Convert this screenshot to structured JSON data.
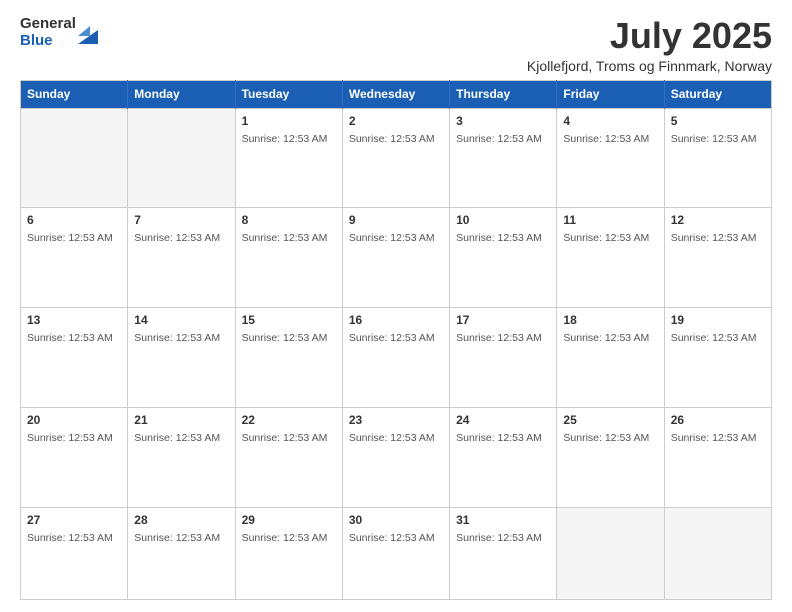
{
  "logo": {
    "general": "General",
    "blue": "Blue"
  },
  "header": {
    "month": "July 2025",
    "location": "Kjollefjord, Troms og Finnmark, Norway"
  },
  "days": [
    "Sunday",
    "Monday",
    "Tuesday",
    "Wednesday",
    "Thursday",
    "Friday",
    "Saturday"
  ],
  "sunrise_label": "Sunrise: 12:53 AM",
  "weeks": [
    [
      {
        "day": "",
        "empty": true
      },
      {
        "day": "",
        "empty": true
      },
      {
        "day": "1",
        "empty": false
      },
      {
        "day": "2",
        "empty": false
      },
      {
        "day": "3",
        "empty": false
      },
      {
        "day": "4",
        "empty": false
      },
      {
        "day": "5",
        "empty": false
      }
    ],
    [
      {
        "day": "6",
        "empty": false
      },
      {
        "day": "7",
        "empty": false
      },
      {
        "day": "8",
        "empty": false
      },
      {
        "day": "9",
        "empty": false
      },
      {
        "day": "10",
        "empty": false
      },
      {
        "day": "11",
        "empty": false
      },
      {
        "day": "12",
        "empty": false
      }
    ],
    [
      {
        "day": "13",
        "empty": false
      },
      {
        "day": "14",
        "empty": false
      },
      {
        "day": "15",
        "empty": false
      },
      {
        "day": "16",
        "empty": false
      },
      {
        "day": "17",
        "empty": false
      },
      {
        "day": "18",
        "empty": false
      },
      {
        "day": "19",
        "empty": false
      }
    ],
    [
      {
        "day": "20",
        "empty": false
      },
      {
        "day": "21",
        "empty": false
      },
      {
        "day": "22",
        "empty": false
      },
      {
        "day": "23",
        "empty": false
      },
      {
        "day": "24",
        "empty": false
      },
      {
        "day": "25",
        "empty": false
      },
      {
        "day": "26",
        "empty": false
      }
    ],
    [
      {
        "day": "27",
        "empty": false
      },
      {
        "day": "28",
        "empty": false
      },
      {
        "day": "29",
        "empty": false
      },
      {
        "day": "30",
        "empty": false
      },
      {
        "day": "31",
        "empty": false
      },
      {
        "day": "",
        "empty": true
      },
      {
        "day": "",
        "empty": true
      }
    ]
  ]
}
